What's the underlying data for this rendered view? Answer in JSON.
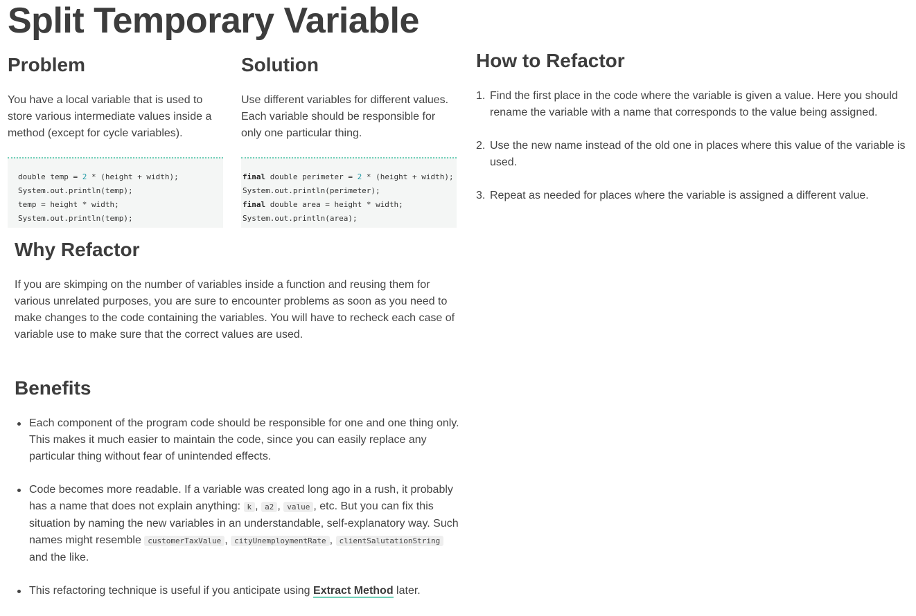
{
  "title": "Split Temporary Variable",
  "problem": {
    "heading": "Problem",
    "text": "You have a local variable that is used to store various intermediate values inside a method (except for cycle variables).",
    "code": [
      [
        {
          "t": "double temp = "
        },
        {
          "t": "2",
          "c": "num"
        },
        {
          "t": " * (height + width);"
        }
      ],
      [
        {
          "t": "System.out.println(temp);"
        }
      ],
      [
        {
          "t": "temp = height * width;"
        }
      ],
      [
        {
          "t": "System.out.println(temp);"
        }
      ]
    ]
  },
  "solution": {
    "heading": "Solution",
    "text": "Use different variables for different values. Each variable should be responsible for only one particular thing.",
    "code": [
      [
        {
          "t": "final",
          "c": "kw"
        },
        {
          "t": " double perimeter = "
        },
        {
          "t": "2",
          "c": "num"
        },
        {
          "t": " * (height + width);"
        }
      ],
      [
        {
          "t": "System.out.println(perimeter);"
        }
      ],
      [
        {
          "t": "final",
          "c": "kw"
        },
        {
          "t": " double area = height * width;"
        }
      ],
      [
        {
          "t": "System.out.println(area);"
        }
      ]
    ]
  },
  "why": {
    "heading": "Why Refactor",
    "text": "If you are skimping on the number of variables inside a function and reusing them for various unrelated purposes, you are sure to encounter problems as soon as you need to make changes to the code containing the variables. You will have to recheck each case of variable use to make sure that the correct values are used."
  },
  "benefits": {
    "heading": "Benefits",
    "items": [
      [
        {
          "t": "Each component of the program code should be responsible for one and one thing only. This makes it much easier to maintain the code, since you can easily replace any particular thing without fear of unintended effects."
        }
      ],
      [
        {
          "t": "Code becomes more readable. If a variable was created long ago in a rush, it probably has a name that does not explain anything: "
        },
        {
          "t": "k",
          "c": "code"
        },
        {
          "t": ", "
        },
        {
          "t": "a2",
          "c": "code"
        },
        {
          "t": ", "
        },
        {
          "t": "value",
          "c": "code"
        },
        {
          "t": ", etc. But you can fix this situation by naming the new variables in an understandable, self-explanatory way. Such names might resemble "
        },
        {
          "t": "customerTaxValue",
          "c": "code"
        },
        {
          "t": ", "
        },
        {
          "t": "cityUnemploymentRate",
          "c": "code"
        },
        {
          "t": ", "
        },
        {
          "t": "clientSalutationString",
          "c": "code"
        },
        {
          "t": " and the like."
        }
      ],
      [
        {
          "t": "This refactoring technique is useful if you anticipate using "
        },
        {
          "t": "Extract Method",
          "c": "link"
        },
        {
          "t": " later."
        }
      ]
    ]
  },
  "how": {
    "heading": "How to Refactor",
    "steps": [
      "Find the first place in the code where the variable is given a value. Here you should rename the variable with a name that corresponds to the value being assigned.",
      "Use the new name instead of the old one in places where this value of the variable is used.",
      "Repeat as needed for places where the variable is assigned a different value."
    ]
  },
  "colors": {
    "accent": "#6fd0b8",
    "number": "#1e9aa5",
    "heading": "#3d3d3d",
    "text": "#444444",
    "code_bg": "#f4f6f5"
  }
}
